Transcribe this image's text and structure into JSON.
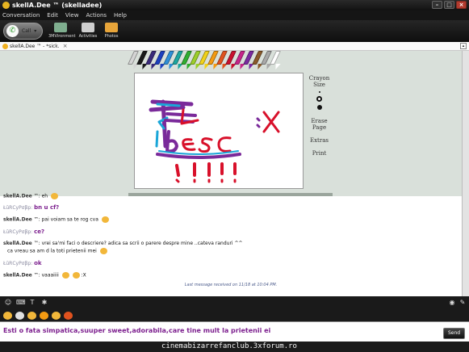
{
  "window": {
    "title": "skellA.Dee ™ (skelladee)"
  },
  "menu": {
    "items": [
      "Conversation",
      "Edit",
      "View",
      "Actions",
      "Help"
    ]
  },
  "toolbar": {
    "call_label": "Call",
    "items": [
      {
        "label": "3MVironment",
        "icon": "3d-environment-icon"
      },
      {
        "label": "Activities",
        "icon": "activities-icon"
      },
      {
        "label": "Photos",
        "icon": "photos-icon"
      }
    ]
  },
  "tab": {
    "label": "skellA.Dee ™ - *sick.",
    "close": "×"
  },
  "drawing": {
    "tools": {
      "crayon_size_label": "Crayon Size",
      "erase_label": "Erase Page",
      "extras_label": "Extras",
      "print_label": "Print"
    },
    "crayon_colors": [
      "#d4d4d4",
      "#1a1a1a",
      "#3a2a7a",
      "#1c3fbf",
      "#2f8fd8",
      "#1ca6a0",
      "#2fae2f",
      "#9ccf2a",
      "#f1d21a",
      "#f39a12",
      "#e0521e",
      "#c8102e",
      "#c6258a",
      "#7b2aa0",
      "#8a5a2a",
      "#a9a9a9",
      "#ffffff"
    ]
  },
  "chat": {
    "messages": [
      {
        "sender": "skellA.Dee",
        "text": "™: eh",
        "emoticon": true
      },
      {
        "sender": "ŁūRϹyPσβp:",
        "text": "bn u cf?",
        "style": "purple"
      },
      {
        "sender": "skellA.Dee",
        "text": "™: pai voiam sa te rog cva",
        "emoticon": true
      },
      {
        "sender": "ŁūRϹyPσβp:",
        "text": "ce?",
        "style": "purple"
      },
      {
        "sender": "skellA.Dee",
        "text": "™: vrei sa'mi faci o descriere? adica sa scrii o parere despre mine ..cateva randuri ^^",
        "continuation": "ca vreau sa am d la toti prietenii mei",
        "emoticon": true
      },
      {
        "sender": "ŁūRϹyPσβp:",
        "text": "ok",
        "style": "purple"
      },
      {
        "sender": "skellA.Dee",
        "text": "™: vaaaiiii",
        "emoticon": true,
        "trail": ":X"
      }
    ],
    "last_message": "Last message received on 11/18 at 10:04 PM."
  },
  "compose": {
    "text": "Esti o fata simpatica,suuper sweet,adorabila,care tine mult la prietenii ei",
    "send_label": "Send"
  },
  "watermark": "cinemabizarrefanclub.3xforum.ro"
}
